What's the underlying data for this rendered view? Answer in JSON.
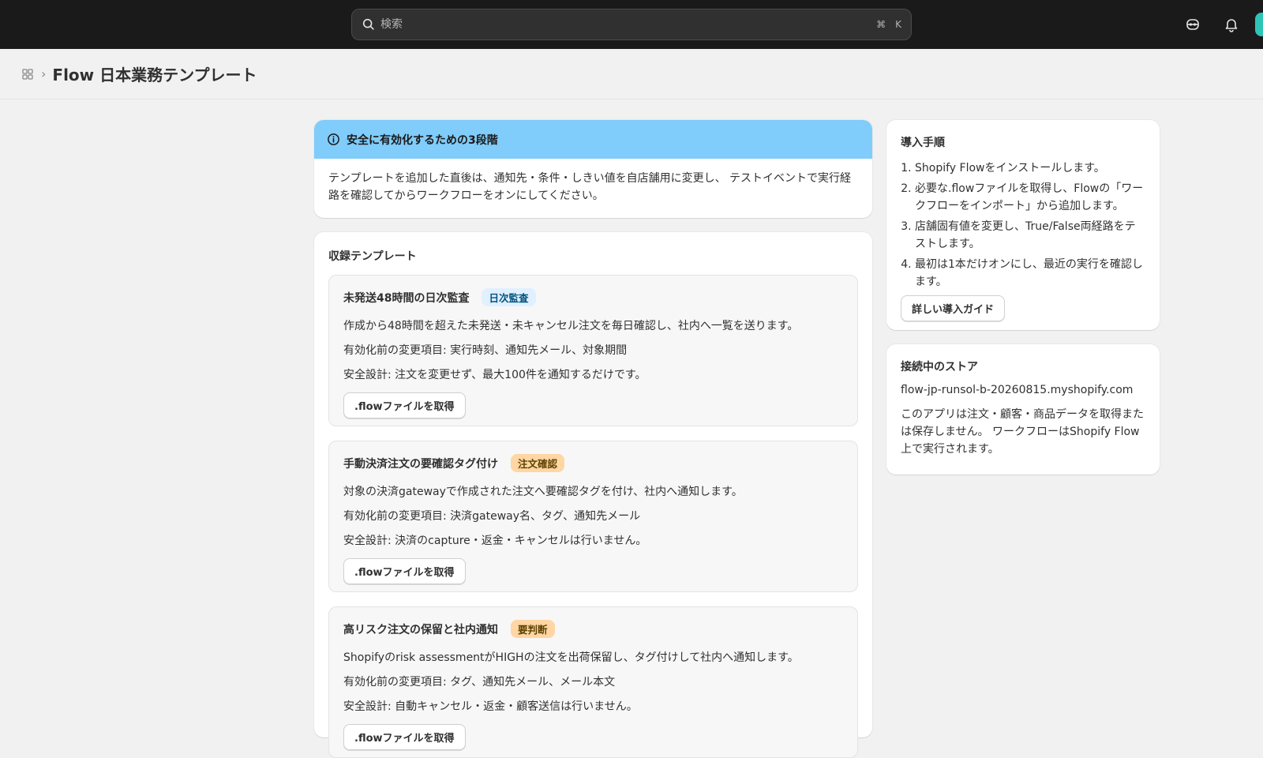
{
  "search": {
    "placeholder": "検索",
    "shortcut_cmd": "⌘",
    "shortcut_key": "K"
  },
  "breadcrumb": {
    "separator": "›",
    "title": "Flow 日本業務テンプレート"
  },
  "banner": {
    "title": "安全に有効化するための3段階",
    "body": "テンプレートを追加した直後は、通知先・条件・しきい値を自店舗用に変更し、 テストイベントで実行経路を確認してからワークフローをオンにしてください。"
  },
  "templates": {
    "section_title": "収録テンプレート",
    "items": [
      {
        "title": "未発送48時間の日次監査",
        "badge": "日次監査",
        "badge_bg": "#e0f0ff",
        "badge_color": "#00527c",
        "description": "作成から48時間を超えた未発送・未キャンセル注文を毎日確認し、社内へ一覧を送ります。",
        "changes": "有効化前の変更項目: 実行時刻、通知先メール、対象期間",
        "safety": "安全設計: 注文を変更せず、最大100件を通知するだけです。",
        "button": ".flowファイルを取得"
      },
      {
        "title": "手動決済注文の要確認タグ付け",
        "badge": "注文確認",
        "badge_bg": "#ffd6a4",
        "badge_color": "#5e4200",
        "description": "対象の決済gatewayで作成された注文へ要確認タグを付け、社内へ通知します。",
        "changes": "有効化前の変更項目: 決済gateway名、タグ、通知先メール",
        "safety": "安全設計: 決済のcapture・返金・キャンセルは行いません。",
        "button": ".flowファイルを取得"
      },
      {
        "title": "高リスク注文の保留と社内通知",
        "badge": "要判断",
        "badge_bg": "#ffd6a4",
        "badge_color": "#5e4200",
        "description": "Shopifyのrisk assessmentがHIGHの注文を出荷保留し、タグ付けして社内へ通知します。",
        "changes": "有効化前の変更項目: タグ、通知先メール、メール本文",
        "safety": "安全設計: 自動キャンセル・返金・顧客送信は行いません。",
        "button": ".flowファイルを取得"
      }
    ]
  },
  "guide": {
    "title": "導入手順",
    "steps": [
      "Shopify Flowをインストールします。",
      "必要な.flowファイルを取得し、Flowの「ワークフローをインポート」から追加します。",
      "店舗固有値を変更し、True/False両経路をテストします。",
      "最初は1本だけオンにし、最近の実行を確認します。"
    ],
    "button": "詳しい導入ガイド"
  },
  "store": {
    "title": "接続中のストア",
    "domain": "flow-jp-runsol-b-20260815.myshopify.com",
    "note": "このアプリは注文・顧客・商品データを取得または保存しません。 ワークフローはShopify Flow上で実行されます。"
  },
  "colors": {
    "topbar": "#1a1a1a",
    "banner": "#80ccfa",
    "avatar": "#2ec4b6"
  }
}
